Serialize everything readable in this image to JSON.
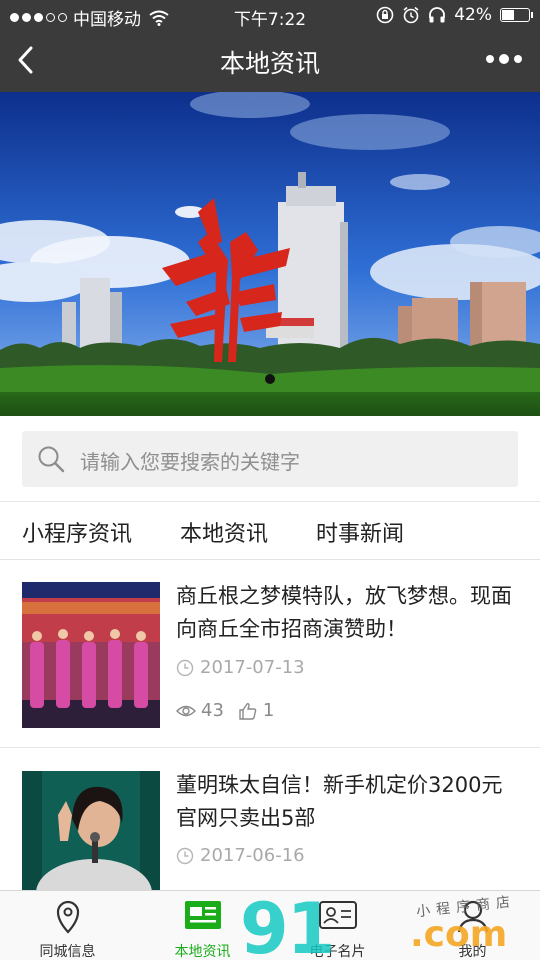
{
  "status_bar": {
    "carrier": "中国移动",
    "time": "下午7:22",
    "battery_percent": "42%",
    "battery_level": 0.42,
    "signal_dots_filled": 3,
    "signal_dots_total": 5
  },
  "navbar": {
    "title": "本地资讯",
    "back_icon": "chevron-left-icon",
    "more_icon": "more-dots-icon"
  },
  "banner": {
    "image": "city-square-red-sculpture"
  },
  "search": {
    "placeholder": "请输入您要搜索的关键字"
  },
  "tabs": [
    {
      "label": "小程序资讯"
    },
    {
      "label": "本地资讯"
    },
    {
      "label": "时事新闻"
    }
  ],
  "articles": [
    {
      "title": "商丘根之梦模特队，放飞梦想。现面向商丘全市招商演赞助！",
      "date": "2017-07-13",
      "views": "43",
      "likes": "1",
      "thumb": "stage-performers-photo"
    },
    {
      "title": "董明珠太自信！新手机定价3200元 官网只卖出5部",
      "date": "2017-06-16",
      "thumb": "speaker-with-microphone-photo"
    }
  ],
  "tabbar": [
    {
      "label": "同城信息",
      "icon": "location-pin-icon",
      "active": false
    },
    {
      "label": "本地资讯",
      "icon": "news-card-icon",
      "active": true
    },
    {
      "label": "电子名片",
      "icon": "contact-card-icon",
      "active": false
    },
    {
      "label": "我的",
      "icon": "user-icon",
      "active": false
    }
  ],
  "watermark": {
    "main": "91",
    "suffix": ".com",
    "shop": "小程序商店"
  },
  "colors": {
    "nav_bg": "#3b3b3b",
    "accent_green": "#1aad19",
    "search_bg": "#f0f0f0",
    "meta_gray": "#a9a9a9"
  }
}
